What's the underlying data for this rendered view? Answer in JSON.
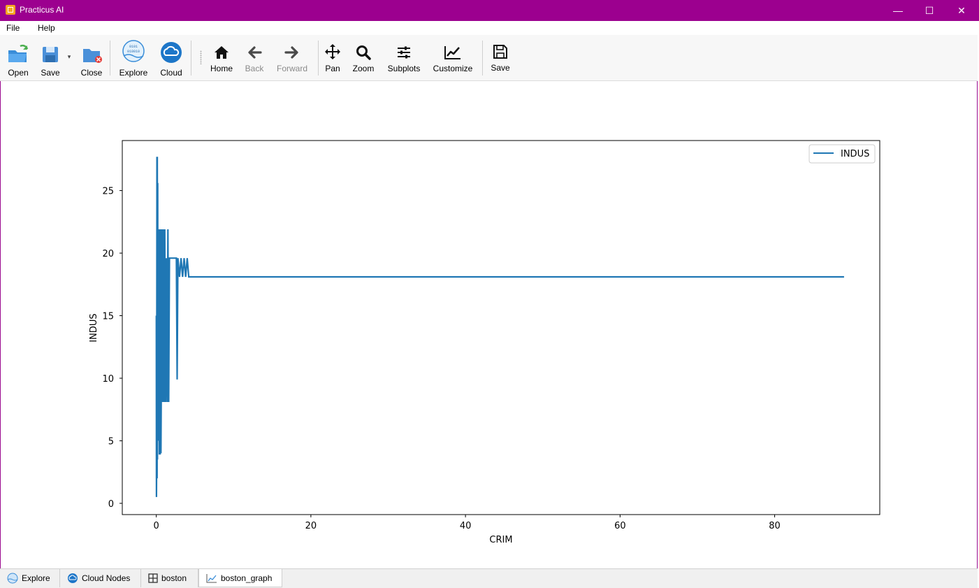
{
  "window": {
    "title": "Practicus AI",
    "minimize": "—",
    "maximize": "☐",
    "close": "✕"
  },
  "menu": {
    "file": "File",
    "help": "Help"
  },
  "toolbar": {
    "open": "Open",
    "save": "Save",
    "close": "Close",
    "explore": "Explore",
    "cloud": "Cloud",
    "home": "Home",
    "back": "Back",
    "forward": "Forward",
    "pan": "Pan",
    "zoom": "Zoom",
    "subplots": "Subplots",
    "customize": "Customize",
    "save_fig": "Save"
  },
  "tabs": [
    {
      "label": "Explore",
      "icon": "globe-icon"
    },
    {
      "label": "Cloud Nodes",
      "icon": "cloud-icon"
    },
    {
      "label": "boston",
      "icon": "table-icon"
    },
    {
      "label": "boston_graph",
      "icon": "line-chart-icon",
      "active": true
    }
  ],
  "chart_data": {
    "type": "line",
    "title": "",
    "xlabel": "CRIM",
    "ylabel": "INDUS",
    "xlim": [
      -4.4,
      93.6
    ],
    "ylim": [
      -0.9,
      29.0
    ],
    "xticks": [
      0,
      20,
      40,
      60,
      80
    ],
    "yticks": [
      0,
      5,
      10,
      15,
      20,
      25
    ],
    "grid": false,
    "legend": "top-right",
    "series_color": "#1f77b4",
    "series": [
      {
        "name": "INDUS",
        "x": [
          0.0,
          0.02,
          0.05,
          0.08,
          0.1,
          0.13,
          0.15,
          0.18,
          0.2,
          0.25,
          0.3,
          0.35,
          0.4,
          0.45,
          0.5,
          0.55,
          0.6,
          0.65,
          0.7,
          0.8,
          0.9,
          1.0,
          1.1,
          1.2,
          1.3,
          1.4,
          1.5,
          1.6,
          1.7,
          1.8,
          2.0,
          2.3,
          2.6,
          2.7,
          2.8,
          3.0,
          3.2,
          3.4,
          3.6,
          3.8,
          4.0,
          4.2,
          4.4,
          5.0,
          10.0,
          20.0,
          40.0,
          60.0,
          80.0,
          88.98
        ],
        "y": [
          15.0,
          0.5,
          4.0,
          27.7,
          2.0,
          27.7,
          3.5,
          25.6,
          6.0,
          21.9,
          5.0,
          21.9,
          3.9,
          21.9,
          3.9,
          21.9,
          4.0,
          10.0,
          21.9,
          8.1,
          21.9,
          8.1,
          21.9,
          8.1,
          19.6,
          8.1,
          21.9,
          8.1,
          19.6,
          19.6,
          19.6,
          19.6,
          19.6,
          9.9,
          19.6,
          18.1,
          19.6,
          18.1,
          19.6,
          18.1,
          19.6,
          18.1,
          18.1,
          18.1,
          18.1,
          18.1,
          18.1,
          18.1,
          18.1,
          18.1
        ]
      }
    ]
  }
}
